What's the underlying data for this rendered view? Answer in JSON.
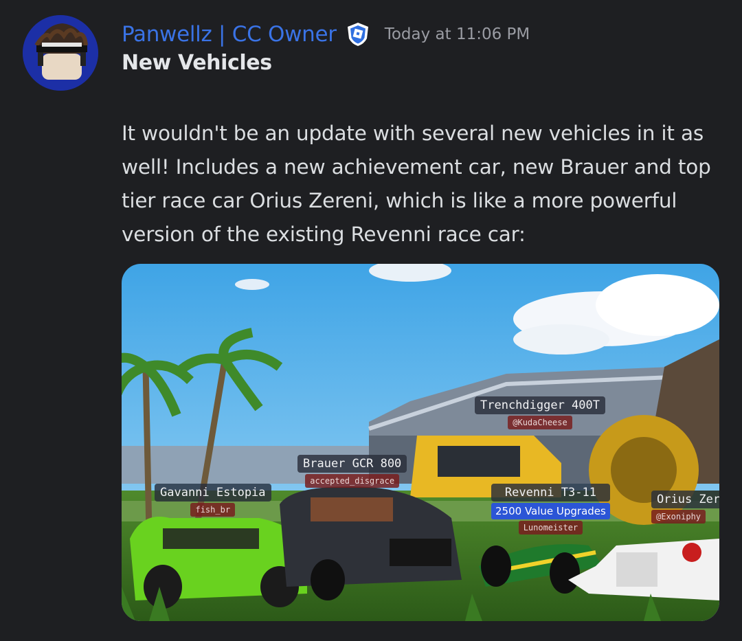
{
  "message": {
    "author": "Panwellz | CC Owner",
    "timestamp": "Today at 11:06 PM",
    "title": "New Vehicles",
    "body": "It wouldn't be an update with several new vehicles in it as well! Includes a new achievement car, new Brauer and top tier race car Orius Zereni, which is like a more powerful version of the existing Revenni race car:",
    "badge_icon": "roblox-shield-icon",
    "accent_color": "#3a73e6"
  },
  "image": {
    "tags": [
      {
        "name": "Trenchdigger 400T",
        "user": "@KudaCheese"
      },
      {
        "name": "Brauer GCR 800",
        "user": "accepted_disgrace"
      },
      {
        "name": "Gavanni Estopia",
        "user": "fish_br"
      },
      {
        "name": "Revenni T3-11",
        "highlight": "2500 Value Upgrades",
        "user": "Lunomeister"
      },
      {
        "name": "Orius Zere",
        "user": "@Exoniphy"
      }
    ]
  }
}
